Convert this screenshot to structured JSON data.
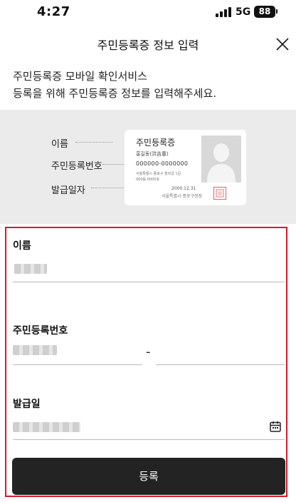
{
  "status_bar": {
    "time": "4:27",
    "network": "5G",
    "battery": "88"
  },
  "header": {
    "title": "주민등록증 정보 입력"
  },
  "intro": {
    "line1": "주민등록증 모바일 확인서비스",
    "line2": "등록을 위해 주민등록증 정보를 입력해주세요."
  },
  "illustration": {
    "labels": {
      "name": "이름",
      "id_number": "주민등록번호",
      "issue_date": "발급일자"
    },
    "card": {
      "title": "주민등록증",
      "name": "홍길동(洪吉童)",
      "number": "000000-0000000",
      "address_line1": "서울특별시 종로구 청와궁 1길",
      "address_line2": "000동 0000호",
      "date": "2000.12.31",
      "issuer": "서울특별시 종로구청장"
    }
  },
  "form": {
    "name_label": "이름",
    "id_label": "주민등록번호",
    "id_separator": "-",
    "issue_label": "발급일",
    "submit_label": "등록"
  }
}
